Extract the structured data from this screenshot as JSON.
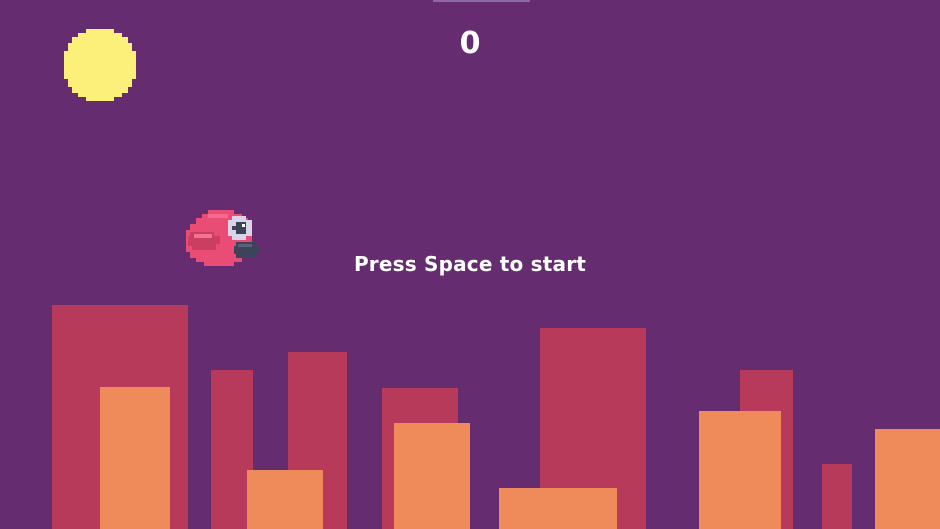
{
  "hud": {
    "score": "0",
    "prompt": "Press Space to start"
  },
  "icons": {
    "sun": "sun-icon",
    "bird": "bird-player-icon"
  },
  "colors": {
    "sky": "#652c6f",
    "sun": "#fdf07a",
    "back_buildings": "#b83a5b",
    "front_buildings": "#ef8a5a",
    "bird_body": "#e94c74",
    "bird_wing": "#cc3d62",
    "bird_beak": "#3d4358"
  }
}
